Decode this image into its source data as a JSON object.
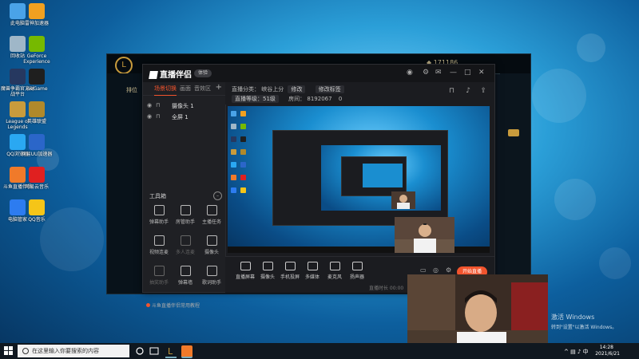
{
  "desktop": {
    "icons": [
      {
        "label": "此电脑",
        "color": "#4aa3e8"
      },
      {
        "label": "雷神加速器",
        "color": "#f0a020"
      },
      {
        "label": "回收站",
        "color": "#9fb7c8"
      },
      {
        "label": "GeForce Experience",
        "color": "#76b900"
      },
      {
        "label": "魔兽争霸官方对战平台",
        "color": "#263860"
      },
      {
        "label": "WeGame",
        "color": "#1f1f1f"
      },
      {
        "label": "League of Legends",
        "color": "#c89b3c"
      },
      {
        "label": "英雄联盟",
        "color": "#b0892b"
      },
      {
        "label": "QQ浏览器",
        "color": "#2aa8f2"
      },
      {
        "label": "网易UU加速器",
        "color": "#2b66c9"
      },
      {
        "label": "斗鱼直播伴侣",
        "color": "#f07a2a"
      },
      {
        "label": "网易云音乐",
        "color": "#e02020"
      },
      {
        "label": "电脑管家",
        "color": "#2d7cf0"
      },
      {
        "label": "QQ音乐",
        "color": "#f5c518"
      }
    ]
  },
  "lol": {
    "coins": "171186",
    "title_hint": "排位"
  },
  "obs": {
    "app_name": "直播伴侣",
    "badge": "体验",
    "tabs": [
      "场景切换",
      "画面",
      "音效区"
    ],
    "sources": [
      "摄像头 1",
      "全屏 1"
    ],
    "tools_header": "工具箱",
    "tools": [
      {
        "label": "弹幕助手",
        "dim": false
      },
      {
        "label": "房管助手",
        "dim": false
      },
      {
        "label": "主播任务",
        "dim": false
      },
      {
        "label": "视频连麦",
        "dim": false
      },
      {
        "label": "多人连麦",
        "dim": true
      },
      {
        "label": "摄像头",
        "dim": false
      },
      {
        "label": "抽奖助手",
        "dim": true
      },
      {
        "label": "弹幕墙",
        "dim": false
      },
      {
        "label": "歌词助手",
        "dim": false
      }
    ],
    "notice": "斗鱼直播伴侣常用教程",
    "info": {
      "room_label": "直播分类：",
      "category": "峡谷上分",
      "edit_label": "修改",
      "more_label": "修改标签",
      "level": "直播等级：51级",
      "fans_label": "房间：",
      "fans_value": "8192067",
      "online": "0"
    },
    "bottom_buttons": [
      "直播屏幕",
      "摄像头",
      "手机投屏",
      "多媒体",
      "麦克风",
      "扬声器"
    ],
    "live_button": "开始直播",
    "status": "直播时长 00:00"
  },
  "windows": {
    "activate_title": "激活 Windows",
    "activate_sub": "转到\"设置\"以激活 Windows。",
    "search_placeholder": "在这里输入你要搜索的内容",
    "time": "14:28",
    "date": "2021/6/21"
  }
}
